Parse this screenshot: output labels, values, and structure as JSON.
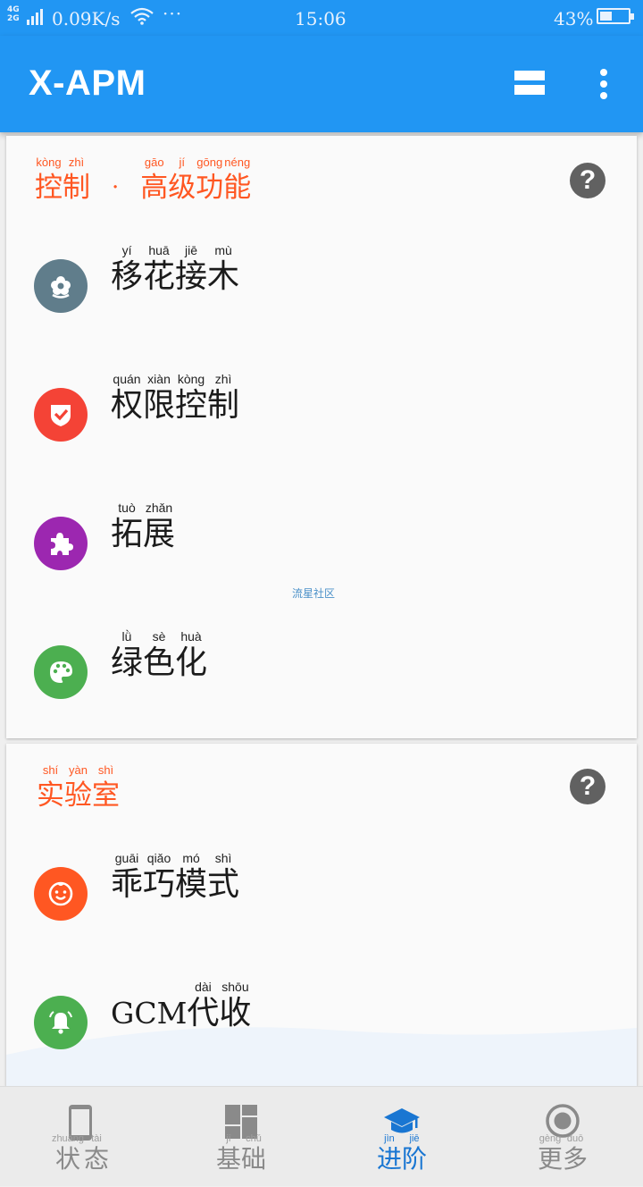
{
  "status_bar": {
    "network_top": "4G",
    "network_bottom": "2G",
    "speed": "0.09K/s",
    "dots": "···",
    "time": "15:06",
    "battery_percent": "43%",
    "battery_level": 0.43
  },
  "app_bar": {
    "title": "X-APM"
  },
  "sections": [
    {
      "title": [
        {
          "py": "kòng",
          "hz": "控"
        },
        {
          "py": "zhì",
          "hz": "制"
        }
      ],
      "separator": "·",
      "title2": [
        {
          "py": "gāo",
          "hz": "高"
        },
        {
          "py": "jí",
          "hz": "级"
        },
        {
          "py": "gōng",
          "hz": "功"
        },
        {
          "py": "néng",
          "hz": "能"
        }
      ],
      "help": "?",
      "items": [
        {
          "name": "cross-graft",
          "icon": "flower-icon",
          "color": "#607d8b",
          "chars": [
            {
              "py": "yí",
              "hz": "移"
            },
            {
              "py": "huā",
              "hz": "花"
            },
            {
              "py": "jiē",
              "hz": "接"
            },
            {
              "py": "mù",
              "hz": "木"
            }
          ]
        },
        {
          "name": "permission-control",
          "icon": "shield-check-icon",
          "color": "#f44336",
          "chars": [
            {
              "py": "quán",
              "hz": "权"
            },
            {
              "py": "xiàn",
              "hz": "限"
            },
            {
              "py": "kòng",
              "hz": "控"
            },
            {
              "py": "zhì",
              "hz": "制"
            }
          ]
        },
        {
          "name": "extension",
          "icon": "puzzle-icon",
          "color": "#9c27b0",
          "chars": [
            {
              "py": "tuò",
              "hz": "拓"
            },
            {
              "py": "zhǎn",
              "hz": "展"
            }
          ]
        },
        {
          "name": "greenify",
          "icon": "palette-icon",
          "color": "#4caf50",
          "chars": [
            {
              "py": "lǜ",
              "hz": "绿"
            },
            {
              "py": "sè",
              "hz": "色"
            },
            {
              "py": "huà",
              "hz": "化"
            }
          ]
        }
      ],
      "watermark": "流星社区"
    },
    {
      "title": [
        {
          "py": "shí",
          "hz": "实"
        },
        {
          "py": "yàn",
          "hz": "验"
        },
        {
          "py": "shì",
          "hz": "室"
        }
      ],
      "help": "?",
      "items": [
        {
          "name": "good-kid-mode",
          "icon": "child-face-icon",
          "color": "#ff5722",
          "chars": [
            {
              "py": "guāi",
              "hz": "乖"
            },
            {
              "py": "qiǎo",
              "hz": "巧"
            },
            {
              "py": "mó",
              "hz": "模"
            },
            {
              "py": "shì",
              "hz": "式"
            }
          ]
        },
        {
          "name": "gcm-proxy",
          "icon": "bell-icon",
          "color": "#4caf50",
          "prefix": "GCM",
          "chars": [
            {
              "py": "dài",
              "hz": "代"
            },
            {
              "py": "shōu",
              "hz": "收"
            }
          ]
        }
      ]
    }
  ],
  "bottom_nav": [
    {
      "name": "status",
      "icon": "phone-icon",
      "chars": [
        {
          "py": "zhuàng",
          "hz": "状"
        },
        {
          "py": "tài",
          "hz": "态"
        }
      ],
      "active": false
    },
    {
      "name": "basic",
      "icon": "dashboard-icon",
      "chars": [
        {
          "py": "jī",
          "hz": "基"
        },
        {
          "py": "chǔ",
          "hz": "础"
        }
      ],
      "active": false
    },
    {
      "name": "advanced",
      "icon": "graduation-cap-icon",
      "chars": [
        {
          "py": "jìn",
          "hz": "进"
        },
        {
          "py": "jiē",
          "hz": "阶"
        }
      ],
      "active": true
    },
    {
      "name": "more",
      "icon": "radio-button-icon",
      "chars": [
        {
          "py": "gèng",
          "hz": "更"
        },
        {
          "py": "duō",
          "hz": "多"
        }
      ],
      "active": false
    }
  ],
  "colors": {
    "primary": "#2196f3",
    "accent": "#ff5722",
    "nav_active": "#1976d2"
  }
}
